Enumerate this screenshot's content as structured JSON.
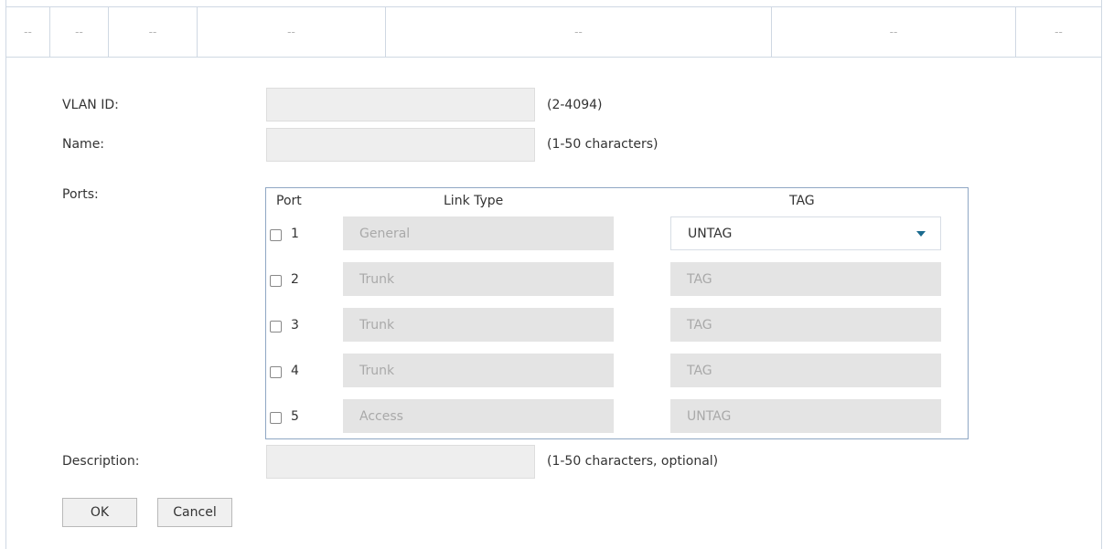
{
  "table_header": {
    "cells": [
      "--",
      "--",
      "--",
      "--",
      "--",
      "--",
      "--"
    ]
  },
  "form": {
    "vlan_id": {
      "label": "VLAN ID:",
      "value": "",
      "hint": "(2-4094)"
    },
    "name": {
      "label": "Name:",
      "value": "",
      "hint": "(1-50 characters)"
    },
    "ports": {
      "label": "Ports:",
      "headers": {
        "port": "Port",
        "link_type": "Link Type",
        "tag": "TAG"
      },
      "rows": [
        {
          "port": "1",
          "checked": false,
          "link_type": "General",
          "tag": "UNTAG",
          "tag_editable": true
        },
        {
          "port": "2",
          "checked": false,
          "link_type": "Trunk",
          "tag": "TAG",
          "tag_editable": false
        },
        {
          "port": "3",
          "checked": false,
          "link_type": "Trunk",
          "tag": "TAG",
          "tag_editable": false
        },
        {
          "port": "4",
          "checked": false,
          "link_type": "Trunk",
          "tag": "TAG",
          "tag_editable": false
        },
        {
          "port": "5",
          "checked": false,
          "link_type": "Access",
          "tag": "UNTAG",
          "tag_editable": false
        }
      ]
    },
    "description": {
      "label": "Description:",
      "value": "",
      "hint": "(1-50 characters, optional)"
    }
  },
  "buttons": {
    "ok": "OK",
    "cancel": "Cancel"
  },
  "colors": {
    "border": "#cfd8e3",
    "field_bg": "#eeeeee",
    "disabled_bg": "#e4e4e4",
    "caret": "#1b6b8f",
    "ports_border": "#8fa7c4"
  }
}
